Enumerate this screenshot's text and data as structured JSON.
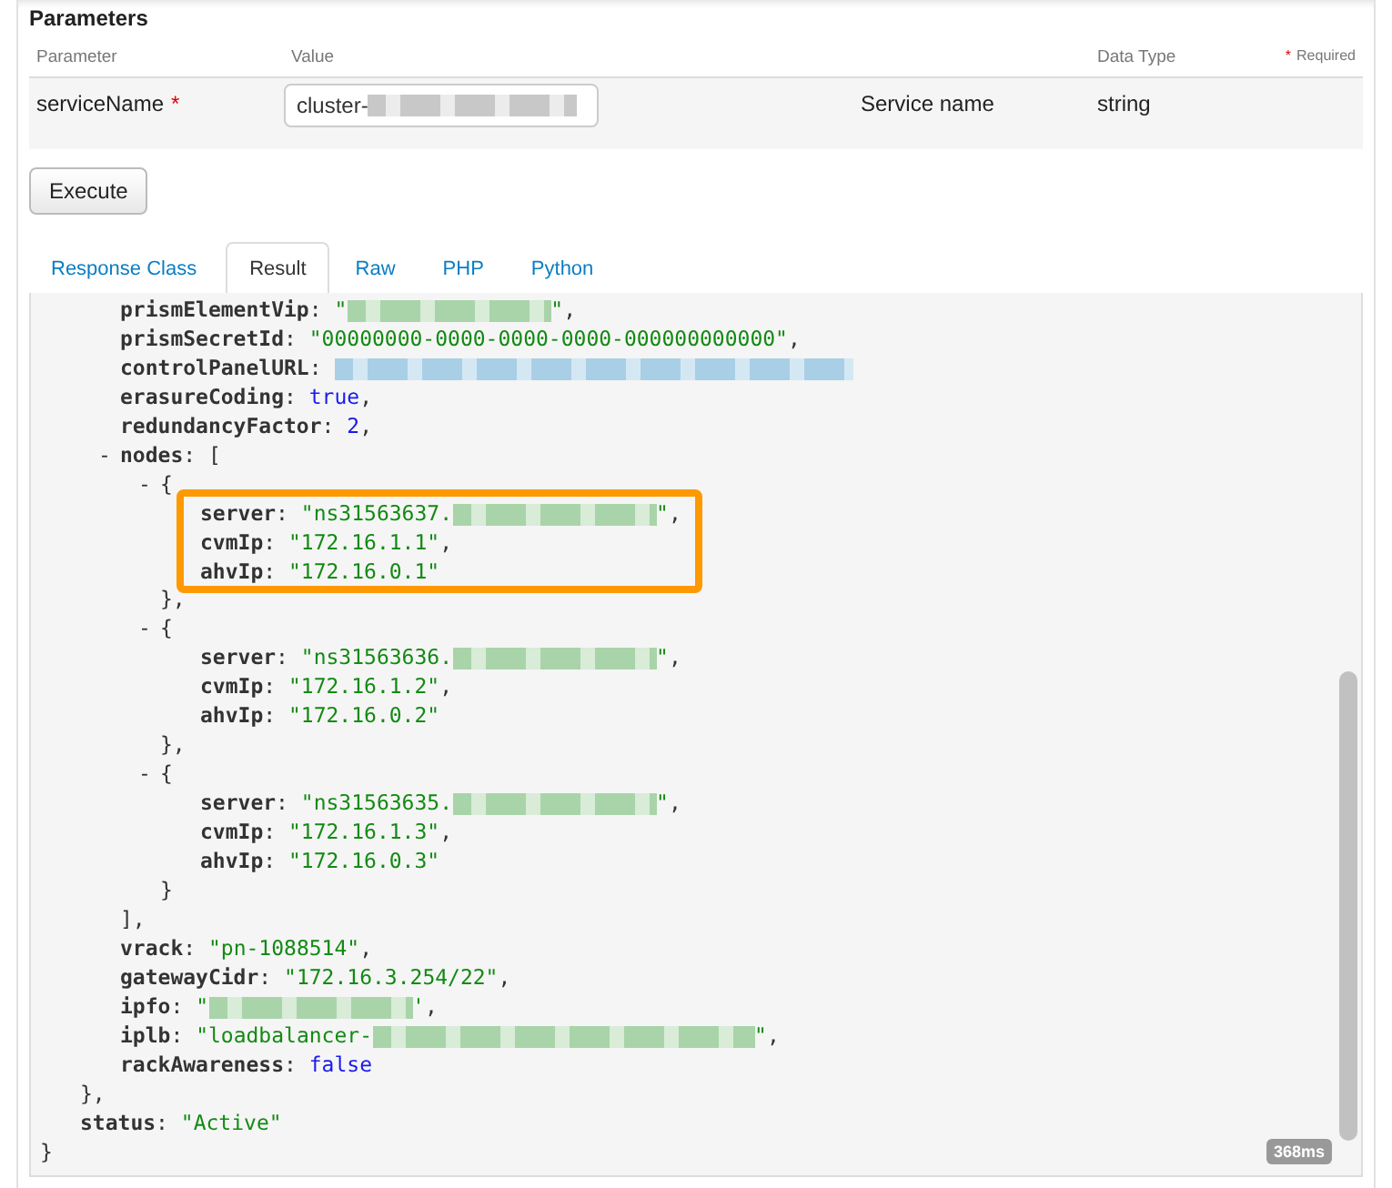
{
  "section_title": "Parameters",
  "params_table": {
    "columns": [
      "Parameter",
      "Value",
      "Data Type"
    ],
    "required_mark": "*",
    "required_note": "Required",
    "rows": [
      {
        "name": "serviceName",
        "required": true,
        "value": "cluster-",
        "value_redacted": true,
        "description": "Service name",
        "data_type": "string"
      }
    ]
  },
  "execute_button": "Execute",
  "tabs": [
    {
      "label": "Response Class",
      "selected": false
    },
    {
      "label": "Result",
      "selected": true
    },
    {
      "label": "Raw",
      "selected": false
    },
    {
      "label": "PHP",
      "selected": false
    },
    {
      "label": "Python",
      "selected": false
    }
  ],
  "result": {
    "timing": "368ms",
    "items": [
      {
        "kind": "object",
        "close": "},",
        "children": [
          {
            "kind": "string",
            "key": "**prismElementVip**:",
            "value": "\"",
            "redacted": true,
            "value_end": "\"",
            "suffix": ","
          },
          {
            "kind": "string",
            "key": "**prismSecretId**:",
            "value": "\"00000000-0000-0000-0000-000000000000\"",
            "suffix": ","
          },
          {
            "kind": "link",
            "key": "**controlPanelURL**:",
            "redacted": true
          },
          {
            "kind": "literal",
            "key": "**erasureCoding**:",
            "value": "true",
            "suffix": ","
          },
          {
            "kind": "literal",
            "key": "**redundancyFactor**:",
            "value": "2",
            "suffix": ","
          },
          {
            "kind": "array",
            "toggle": "-",
            "key": "**nodes**:",
            "open": "[",
            "close": "],",
            "children": [
              {
                "kind": "object",
                "toggle": "-",
                "open": "{",
                "close": "},",
                "highlighted": true,
                "children": [
                  {
                    "kind": "string",
                    "key": "**server**:",
                    "value": "\"ns31563637.",
                    "redacted": true,
                    "value_end": "\"",
                    "suffix": ","
                  },
                  {
                    "kind": "string",
                    "key": "**cvmIp**:",
                    "value": "\"172.16.1.1\"",
                    "suffix": ","
                  },
                  {
                    "kind": "string",
                    "key": "**ahvIp**:",
                    "value": "\"172.16.0.1\""
                  }
                ]
              },
              {
                "kind": "object",
                "toggle": "-",
                "open": "{",
                "close": "},",
                "highlighted": false,
                "children": [
                  {
                    "kind": "string",
                    "key": "**server**:",
                    "value": "\"ns31563636.",
                    "redacted": true,
                    "value_end": "\"",
                    "suffix": ","
                  },
                  {
                    "kind": "string",
                    "key": "**cvmIp**:",
                    "value": "\"172.16.1.2\"",
                    "suffix": ","
                  },
                  {
                    "kind": "string",
                    "key": "**ahvIp**:",
                    "value": "\"172.16.0.2\""
                  }
                ]
              },
              {
                "kind": "object",
                "toggle": "-",
                "open": "{",
                "close": "}",
                "highlighted": false,
                "children": [
                  {
                    "kind": "string",
                    "key": "**server**:",
                    "value": "\"ns31563635.",
                    "redacted": true,
                    "value_end": "\"",
                    "suffix": ","
                  },
                  {
                    "kind": "string",
                    "key": "**cvmIp**:",
                    "value": "\"172.16.1.3\"",
                    "suffix": ","
                  },
                  {
                    "kind": "string",
                    "key": "**ahvIp**:",
                    "value": "\"172.16.0.3\""
                  }
                ]
              }
            ]
          },
          {
            "kind": "string",
            "key": "**vrack**:",
            "value": "\"pn-1088514\"",
            "suffix": ","
          },
          {
            "kind": "string",
            "key": "**gatewayCidr**:",
            "value": "\"172.16.3.254/22\"",
            "suffix": ","
          },
          {
            "kind": "string",
            "key": "**ipfo**:",
            "value": "\"",
            "redacted": true,
            "value_end": "'",
            "suffix": ","
          },
          {
            "kind": "string",
            "key": "**iplb**:",
            "value": "\"loadbalancer-",
            "redacted": true,
            "wide": true,
            "value_end": "\"",
            "suffix": ","
          },
          {
            "kind": "literal",
            "key": "**rackAwareness**:",
            "value": "false"
          }
        ]
      },
      {
        "kind": "string",
        "key": "**status**:",
        "value": "\"Active\""
      }
    ],
    "close": "}"
  }
}
